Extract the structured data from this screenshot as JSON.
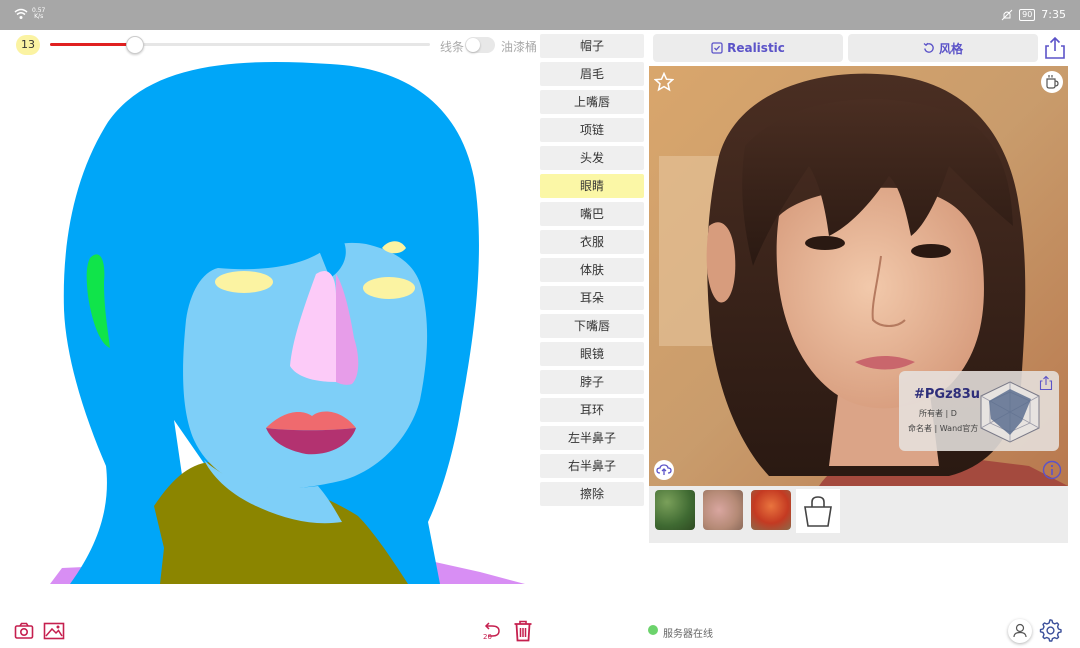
{
  "statusbar": {
    "speed_value": "0.57",
    "speed_unit": "K/s",
    "battery": "90",
    "time": "7:35"
  },
  "brush": {
    "size": "13",
    "size_fraction": 0.22
  },
  "mode": {
    "line_label": "线条",
    "paint_label": "油漆桶",
    "toggle_on": false
  },
  "labels": [
    {
      "label": "帽子",
      "selected": false
    },
    {
      "label": "眉毛",
      "selected": false
    },
    {
      "label": "上嘴唇",
      "selected": false
    },
    {
      "label": "项链",
      "selected": false
    },
    {
      "label": "头发",
      "selected": false
    },
    {
      "label": "眼睛",
      "selected": true
    },
    {
      "label": "嘴巴",
      "selected": false
    },
    {
      "label": "衣服",
      "selected": false
    },
    {
      "label": "体肤",
      "selected": false
    },
    {
      "label": "耳朵",
      "selected": false
    },
    {
      "label": "下嘴唇",
      "selected": false
    },
    {
      "label": "眼镜",
      "selected": false
    },
    {
      "label": "脖子",
      "selected": false
    },
    {
      "label": "耳环",
      "selected": false
    },
    {
      "label": "左半鼻子",
      "selected": false
    },
    {
      "label": "右半鼻子",
      "selected": false
    },
    {
      "label": "擦除",
      "selected": false
    }
  ],
  "toolbar": {
    "realistic_label": "Realistic",
    "style_label": "风格"
  },
  "result_card": {
    "id": "#PGz83u",
    "owner": "所有者 | D",
    "namer": "命名者 | Wand官方"
  },
  "undo": {
    "count": "20"
  },
  "server": {
    "status_text": "服务器在线"
  },
  "colors": {
    "accent": "#5b53c8",
    "slider_red": "#e02020",
    "hair": "#00a6f8",
    "skin": "#7ecff8",
    "clothes": "#8b8500",
    "eyes": "#fbf3a2",
    "nose_left": "#fccbf8",
    "nose_right": "#e79de9",
    "upper_lip": "#ef6a6e",
    "lower_lip": "#b33270",
    "ear": "#10e44a",
    "neckline": "#d88ef4",
    "online": "#6cd36c",
    "icon_pink": "#c51f4e"
  },
  "icons": [
    "wifi-icon",
    "silent-icon",
    "battery-icon",
    "camera-icon",
    "gallery-icon",
    "undo-icon",
    "trash-icon",
    "check-icon",
    "refresh-icon",
    "share-icon",
    "star-icon",
    "cup-icon",
    "upload-icon",
    "info-icon",
    "bag-icon",
    "user-icon",
    "gear-icon"
  ]
}
